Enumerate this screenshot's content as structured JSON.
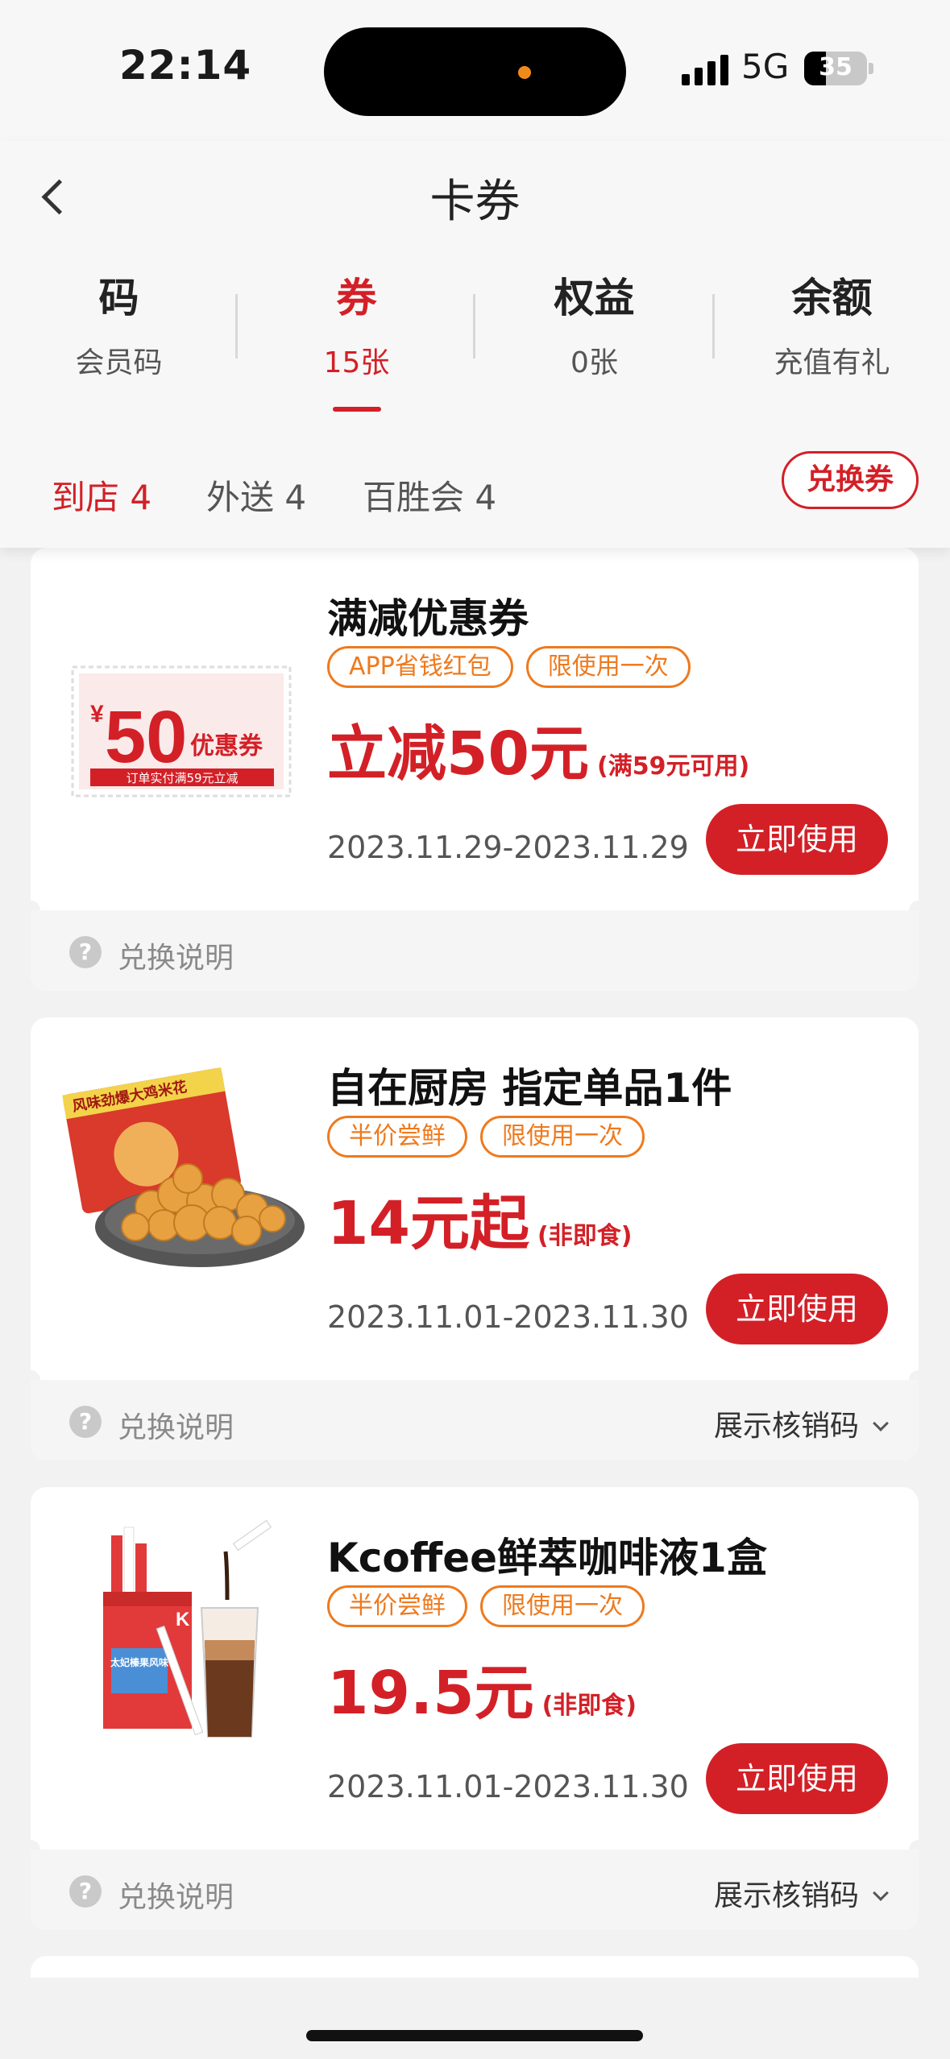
{
  "status": {
    "time": "22:14",
    "network": "5G",
    "battery": "35",
    "battery_level": 0.35
  },
  "header": {
    "title": "卡券"
  },
  "top_tabs": [
    {
      "title": "码",
      "sub": "会员码",
      "active": false
    },
    {
      "title": "券",
      "sub": "15张",
      "active": true
    },
    {
      "title": "权益",
      "sub": "0张",
      "active": false
    },
    {
      "title": "余额",
      "sub": "充值有礼",
      "active": false
    }
  ],
  "sub_tabs": [
    {
      "label": "到店 4",
      "active": true
    },
    {
      "label": "外送 4",
      "active": false
    },
    {
      "label": "百胜会 4",
      "active": false
    }
  ],
  "redeem_label": "兑换券",
  "coupons": [
    {
      "title": "满减优惠券",
      "tags": [
        "APP省钱红包",
        "限使用一次"
      ],
      "price": "立减50元",
      "price_note": "(满59元可用)",
      "dates": "2023.11.29-2023.11.29",
      "use_label": "立即使用",
      "footer_left": "兑换说明",
      "footer_right": "",
      "thumb": {
        "symbol": "¥",
        "amount": "50",
        "label": "优惠券",
        "caption": "订单实付满59元立减"
      }
    },
    {
      "title": "自在厨房 指定单品1件",
      "tags": [
        "半价尝鲜",
        "限使用一次"
      ],
      "price": "14元起",
      "price_note": "(非即食)",
      "dates": "2023.11.01-2023.11.30",
      "use_label": "立即使用",
      "footer_left": "兑换说明",
      "footer_right": "展示核销码",
      "thumb": {
        "pack_text": "风味劲爆大鸡米花"
      }
    },
    {
      "title": "Kcoffee鲜萃咖啡液1盒",
      "tags": [
        "半价尝鲜",
        "限使用一次"
      ],
      "price": "19.5元",
      "price_note": "(非即食)",
      "dates": "2023.11.01-2023.11.30",
      "use_label": "立即使用",
      "footer_left": "兑换说明",
      "footer_right": "展示核销码",
      "thumb": {
        "box_text": "太妃榛果风味",
        "box_logo": "K"
      }
    }
  ],
  "colors": {
    "accent": "#d32027",
    "tag": "#ee7a1e"
  }
}
